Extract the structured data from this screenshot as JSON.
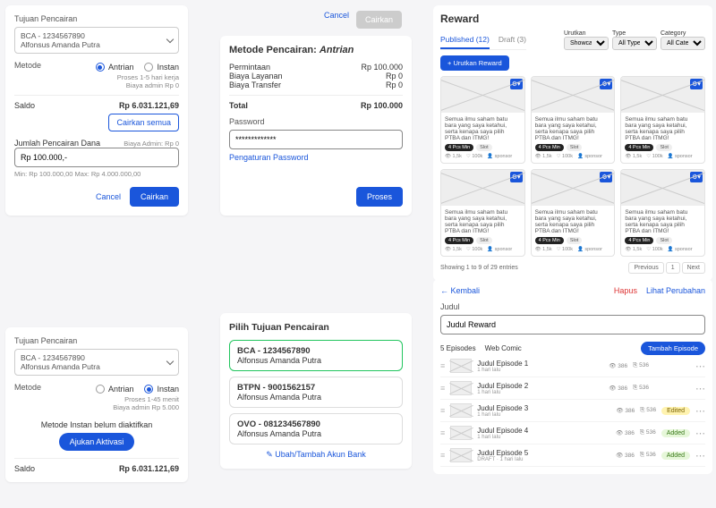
{
  "panel1": {
    "tujuan_label": "Tujuan Pencairan",
    "account_line1": "BCA - 1234567890",
    "account_line2": "Alfonsus Amanda Putra",
    "metode_label": "Metode",
    "radio_antrian": "Antrian",
    "radio_instan": "Instan",
    "hint1": "Proses 1-5 hari kerja",
    "hint2": "Biaya admin Rp 0",
    "saldo_label": "Saldo",
    "saldo_value": "Rp 6.031.121,69",
    "cairkan_semua": "Cairkan semua",
    "jumlah_label": "Jumlah Pencairan Dana",
    "biaya_admin": "Biaya Admin: Rp 0",
    "amount_value": "Rp 100.000,-",
    "minmax": "Min: Rp 100.000,00   Max: Rp 4.000.000,00",
    "cancel": "Cancel",
    "cairkan": "Cairkan"
  },
  "panel1b": {
    "tujuan_label": "Tujuan Pencairan",
    "account_line1": "BCA - 1234567890",
    "account_line2": "Alfonsus Amanda Putra",
    "metode_label": "Metode",
    "radio_antrian": "Antrian",
    "radio_instan": "Instan",
    "hint1": "Proses 1-45 menit",
    "hint2": "Biaya admin Rp 5.000",
    "not_active": "Metode Instan belum diaktifkan",
    "ajukan": "Ajukan Aktivasi",
    "saldo_label": "Saldo",
    "saldo_value": "Rp 6.031.121,69"
  },
  "topbtns": {
    "cancel": "Cancel",
    "cairkan": "Cairkan"
  },
  "panel2": {
    "title_pre": "Metode Pencairan: ",
    "title_em": "Antrian",
    "rows": {
      "permintaan_l": "Permintaan",
      "permintaan_v": "Rp 100.000",
      "layanan_l": "Biaya Layanan",
      "layanan_v": "Rp 0",
      "transfer_l": "Biaya Transfer",
      "transfer_v": "Rp 0",
      "total_l": "Total",
      "total_v": "Rp 100.000"
    },
    "pw_label": "Password",
    "pw_value": "*************",
    "pw_link": "Pengaturan Password",
    "proses": "Proses"
  },
  "panel3": {
    "title": "Pilih Tujuan Pencairan",
    "items": [
      {
        "t": "BCA - 1234567890",
        "s": "Alfonsus Amanda Putra"
      },
      {
        "t": "BTPN - 9001562157",
        "s": "Alfonsus Amanda Putra"
      },
      {
        "t": "OVO - 081234567890",
        "s": "Alfonsus Amanda Putra"
      }
    ],
    "edit": "Ubah/Tambah Akun Bank"
  },
  "reward": {
    "title": "Reward",
    "tab1": "Published (12)",
    "tab2": "Draft (3)",
    "f1l": "Urutkan",
    "f1v": "Showcase",
    "f2l": "Type",
    "f2v": "All Type",
    "f3l": "Category",
    "f3v": "All Category",
    "btn": "+ Urutkan Reward",
    "card_text": "Semua ilmu saham batu bara yang saya ketahui, serta kenapa saya pilih PTBA dan ITMG!",
    "tag1": "4 Pcs Min",
    "tag2": "Slot",
    "m1": "1,5k",
    "m2": "100k",
    "m3": "sponsor",
    "showing": "Showing 1 to 9 of 29 entries",
    "prev": "Previous",
    "p1": "1",
    "next": "Next"
  },
  "editor": {
    "back": "Kembali",
    "hapus": "Hapus",
    "lihat": "Lihat Perubahan",
    "judul_label": "Judul",
    "judul_value": "Judul Reward",
    "eps": "5 Episodes",
    "type": "Web Comic",
    "add": "Tambah Episode",
    "rows": [
      {
        "t": "Judul Episode 1",
        "s": "1 hari lalu",
        "v1": "386",
        "v2": "536",
        "b": ""
      },
      {
        "t": "Judul Episode 2",
        "s": "1 hari lalu",
        "v1": "386",
        "v2": "536",
        "b": ""
      },
      {
        "t": "Judul Episode 3",
        "s": "1 hari lalu",
        "v1": "386",
        "v2": "536",
        "b": "Edited"
      },
      {
        "t": "Judul Episode 4",
        "s": "1 hari lalu",
        "v1": "386",
        "v2": "536",
        "b": "Added"
      },
      {
        "t": "Judul Episode 5",
        "s": "DRAFT · 1 hari lalu",
        "v1": "386",
        "v2": "536",
        "b": "Added"
      }
    ]
  }
}
